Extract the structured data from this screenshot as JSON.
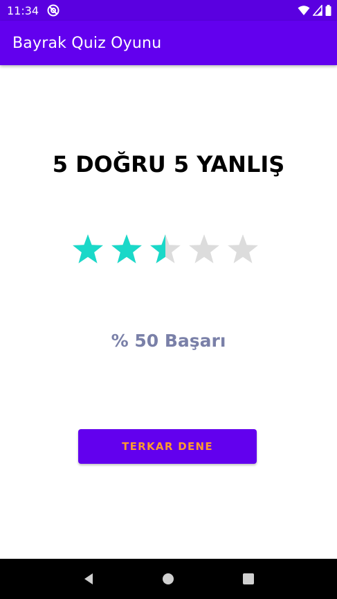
{
  "status_bar": {
    "time": "11:34",
    "icons": [
      "app-notification-icon",
      "wifi-icon",
      "signal-icon",
      "battery-icon"
    ]
  },
  "app_bar": {
    "title": "Bayrak Quiz Oyunu"
  },
  "result": {
    "title": "5 DOĞRU 5 YANLIŞ",
    "rating": 2.5,
    "rating_max": 5,
    "success_prefix": "%",
    "success_value": "50",
    "success_label": "Başarı"
  },
  "retry_button": {
    "label": "TERKAR DENE"
  },
  "nav_bar": {
    "icons": [
      "back-icon",
      "home-icon",
      "recents-icon"
    ]
  },
  "colors": {
    "status_bar": "#5a00e0",
    "app_bar": "#6200ee",
    "star_filled": "#1ad8c8",
    "star_empty": "#dcdcdc",
    "success_text": "#7a80a8",
    "button_text": "#ff9a2e"
  }
}
